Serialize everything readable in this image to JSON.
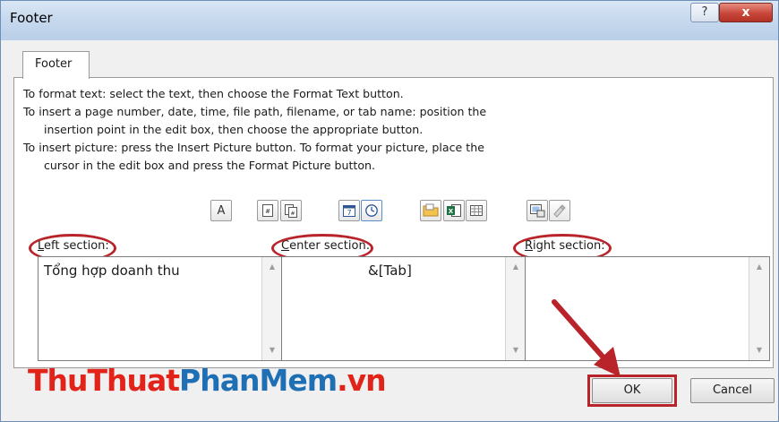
{
  "window": {
    "title": "Footer",
    "help_label": "?",
    "close_label": "x"
  },
  "tab": {
    "label": "Footer"
  },
  "instructions": [
    "To format text:  select the text, then choose the Format Text button.",
    "To insert a page number, date, time, file path, filename, or tab name:  position the",
    "insertion point in the edit box, then choose the appropriate button.",
    "To insert picture: press the Insert Picture button.  To format your picture, place the",
    "cursor in the edit box and press the Format Picture button."
  ],
  "toolbar": {
    "format_text": {
      "label": "A",
      "icon": "format-text-icon"
    },
    "page_number": {
      "label": "#",
      "icon": "page-number-icon"
    },
    "number_of_pages": {
      "label": "#",
      "icon": "number-of-pages-icon"
    },
    "date": {
      "label": "7",
      "icon": "calendar-icon"
    },
    "time": {
      "icon": "clock-icon"
    },
    "file_path": {
      "icon": "folder-icon"
    },
    "file_name": {
      "icon": "excel-file-icon"
    },
    "sheet_name": {
      "icon": "sheet-icon"
    },
    "insert_picture": {
      "icon": "picture-icon"
    },
    "format_picture": {
      "icon": "format-picture-icon"
    }
  },
  "sections": {
    "left": {
      "label_underline": "L",
      "label_rest": "eft section:",
      "value": "Tổng hợp doanh thu"
    },
    "center": {
      "label_underline": "C",
      "label_rest": "enter section:",
      "value": "&[Tab]"
    },
    "right": {
      "label_underline": "R",
      "label_rest": "ight section:",
      "value": ""
    }
  },
  "buttons": {
    "ok": "OK",
    "cancel": "Cancel"
  },
  "brand": {
    "part1": "ThuThuat",
    "part2": "PhanMem",
    "part3": ".vn"
  },
  "colors": {
    "annotation_red": "#b8242a",
    "brand_red": "#e2231a",
    "brand_blue": "#1f6fb5",
    "title_bar": "#c7d9ee"
  }
}
